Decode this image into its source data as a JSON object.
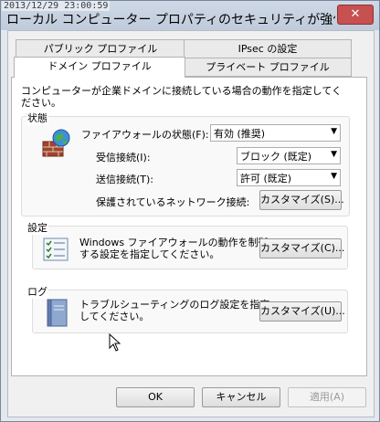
{
  "timestamp": "2013/12/29 23:00:59",
  "window": {
    "title": "ローカル コンピューター プロパティのセキュリティが強化された Windows",
    "close_glyph": "✕"
  },
  "tabs": [
    {
      "label": "パブリック プロファイル"
    },
    {
      "label": "IPsec の設定"
    },
    {
      "label": "ドメイン プロファイル",
      "active": true
    },
    {
      "label": "プライベート プロファイル"
    }
  ],
  "description": "コンピューターが企業ドメインに接続している場合の動作を指定してください。",
  "state_group": {
    "label": "状態",
    "firewall_state_label": "ファイアウォールの状態(F):",
    "firewall_state_value": "有効 (推奨)",
    "inbound_label": "受信接続(I):",
    "inbound_value": "ブロック (既定)",
    "outbound_label": "送信接続(T):",
    "outbound_value": "許可 (既定)",
    "protected_label": "保護されているネットワーク接続:",
    "protected_button": "カスタマイズ(S)..."
  },
  "settings_group": {
    "label": "設定",
    "text_line1": "Windows ファイアウォールの動作を制御",
    "text_line2": "する設定を指定してください。",
    "button": "カスタマイズ(C)..."
  },
  "log_group": {
    "label": "ログ",
    "text_line1": "トラブルシューティングのログ設定を指定",
    "text_line2": "してください。",
    "button": "カスタマイズ(U)..."
  },
  "footer": {
    "ok": "OK",
    "cancel": "キャンセル",
    "apply": "適用(A)"
  },
  "colors": {
    "titlebar": "#c5d1e0",
    "close": "#c75050",
    "panel": "#ffffff"
  }
}
